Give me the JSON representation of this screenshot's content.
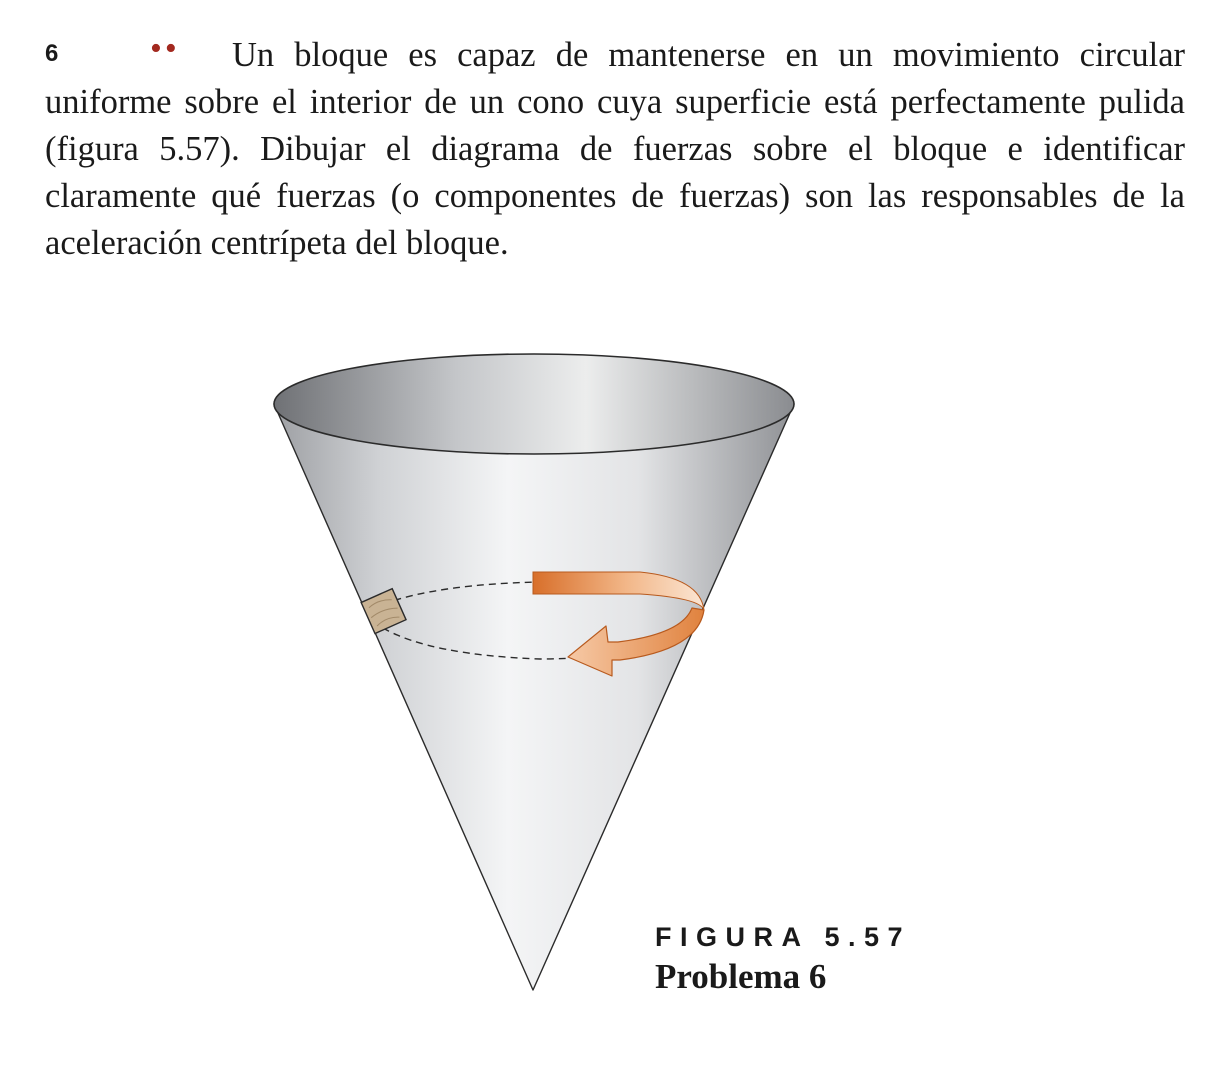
{
  "problem": {
    "number": "6",
    "difficulty_marks": "••",
    "difficulty_color": "#a3291f",
    "text": "Un bloque es capaz de mantenerse en un movimiento circular uniforme sobre el interior de un cono cuya superficie está perfectamente pulida (figura 5.57). Dibujar el diagrama de fuerzas sobre el bloque e identificar claramente qué fuerzas (o componentes de fuerzas) son las responsables de la aceleración centrípeta del bloque."
  },
  "figure": {
    "label": "FIGURA 5.57",
    "title": "Problema 6",
    "arrow_color": "#e0823e",
    "block_color": "#c9b394"
  }
}
